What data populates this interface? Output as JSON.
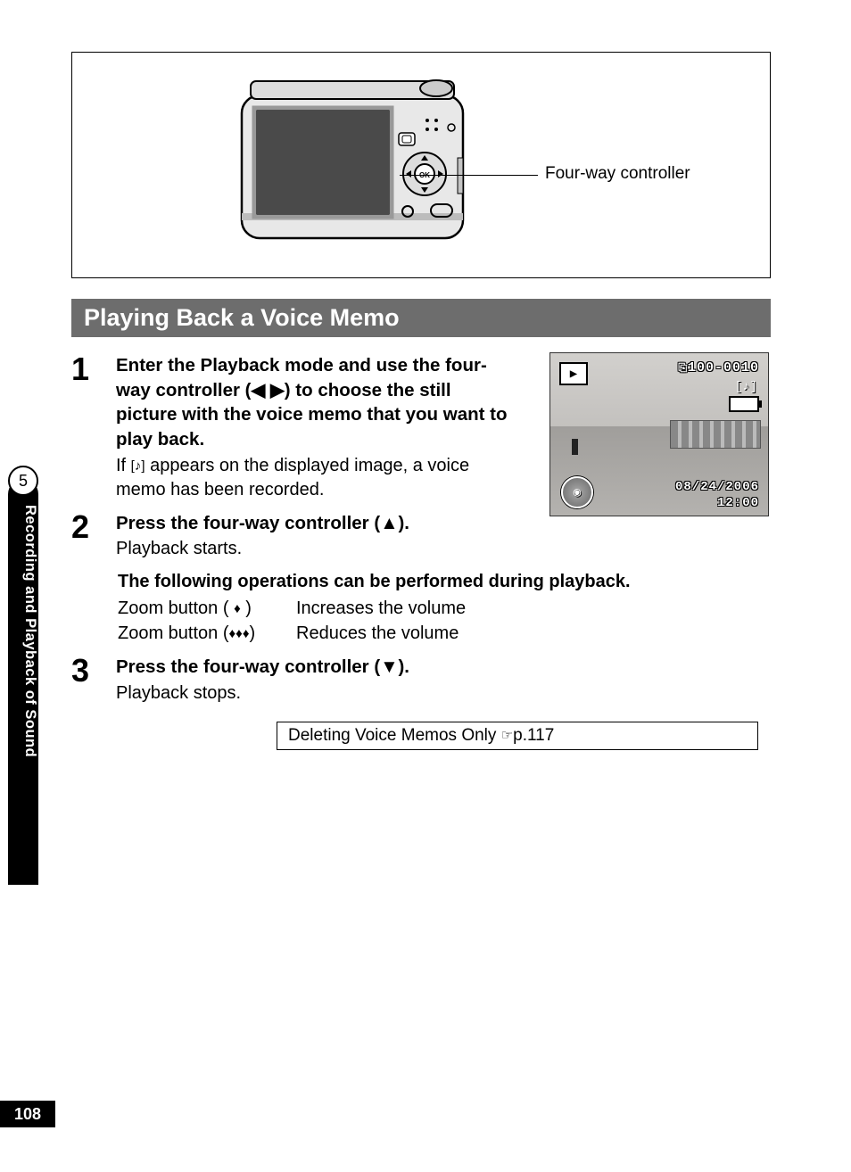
{
  "illustration": {
    "callout": "Four-way controller"
  },
  "section_title": "Playing Back a Voice Memo",
  "steps": {
    "s1": {
      "num": "1",
      "head_pre": "Enter the Playback mode and use the four-way controller (",
      "head_arrows": "◀ ▶",
      "head_post": ") to choose the still picture with the voice memo that you want to play back.",
      "sub_pre": "If ",
      "sub_icon": "[♪]",
      "sub_post": " appears on the displayed image, a voice memo has been recorded."
    },
    "s2": {
      "num": "2",
      "head_pre": "Press the four-way controller (",
      "head_arrow": "▲",
      "head_post": ").",
      "sub": "Playback starts."
    },
    "ops": {
      "heading": "The following operations can be performed during playback.",
      "row1_l_pre": "Zoom button ( ",
      "row1_l_icon": "♦",
      "row1_l_post": " )",
      "row1_r": "Increases the volume",
      "row2_l_pre": "Zoom button (",
      "row2_l_icon": "♦♦♦",
      "row2_l_post": ")",
      "row2_r": "Reduces the volume"
    },
    "s3": {
      "num": "3",
      "head_pre": "Press the four-way controller (",
      "head_arrow": "▼",
      "head_post": ").",
      "sub": "Playback stops."
    }
  },
  "xref": {
    "text": "Deleting Voice Memos Only ",
    "icon": "☞",
    "page": "p.117"
  },
  "lcd": {
    "folder": "100-0010",
    "date": "08/24/2006",
    "time": "12:00"
  },
  "side": {
    "chapter_num": "5",
    "label": "Recording and Playback of Sound"
  },
  "page_number": "108"
}
